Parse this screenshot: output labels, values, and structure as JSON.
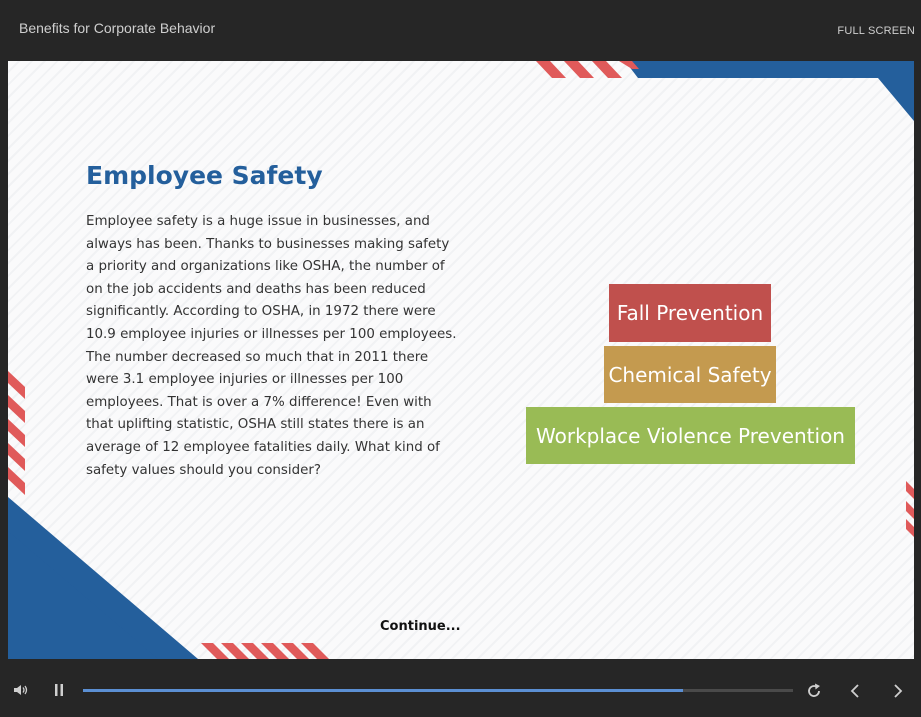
{
  "header": {
    "course_title": "Benefits for Corporate Behavior",
    "fullscreen_label": "FULL SCREEN"
  },
  "slide": {
    "heading": "Employee Safety",
    "body": "Employee safety is a huge issue in businesses, and always has been. Thanks to businesses making safety a priority and organizations like OSHA, the number of on the job accidents and deaths has been reduced significantly. According to OSHA, in 1972 there were 10.9 employee injuries or illnesses per 100 employees. The number decreased so much that in 2011 there were 3.1 employee injuries or illnesses per 100 employees. That is over a 7% difference! Even with that uplifting statistic, OSHA still states there is an average of 12 employee fatalities daily. What kind of safety values should you consider?",
    "pyramid": [
      {
        "label": "Fall Prevention",
        "color": "#c0504d"
      },
      {
        "label": "Chemical Safety",
        "color": "#c49a4f"
      },
      {
        "label": "Workplace Violence Prevention",
        "color": "#99bb55"
      }
    ],
    "continue_label": "Continue..."
  },
  "player": {
    "progress": 0.845,
    "icons": [
      "volume-icon",
      "pause-icon",
      "replay-icon",
      "previous-icon",
      "next-icon"
    ]
  },
  "colors": {
    "accent_blue": "#245f9c",
    "stripe_red": "#e05a5a",
    "progress": "#5b8fd3",
    "chrome": "#262626"
  }
}
